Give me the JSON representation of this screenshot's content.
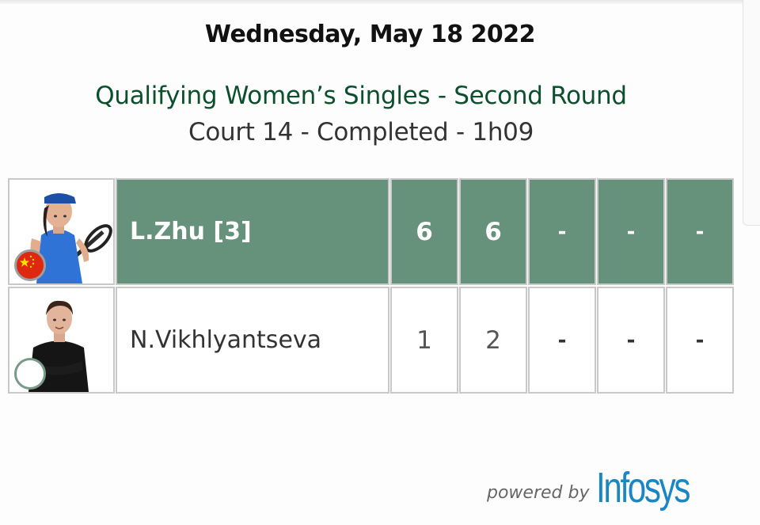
{
  "header": {
    "date": "Wednesday, May 18 2022",
    "round": "Qualifying Women’s Singles - Second Round",
    "court_status": "Court 14 - Completed - 1h09"
  },
  "match": {
    "players": [
      {
        "name": "L.Zhu [3]",
        "winner": true,
        "flag_icon": "china-flag-icon",
        "photo_icon": "player-photo-zhu",
        "scores": [
          "6",
          "6",
          "-",
          "-",
          "-"
        ]
      },
      {
        "name": "N.Vikhlyantseva",
        "winner": false,
        "flag_icon": "empty-flag-icon",
        "photo_icon": "player-photo-vikhlyantseva",
        "scores": [
          "1",
          "2",
          "-",
          "-",
          "-"
        ]
      }
    ]
  },
  "footer": {
    "powered_by": "powered by",
    "brand": "Infosys"
  },
  "colors": {
    "winner_row": "#66917a",
    "round_title": "#0b4f2d",
    "brand": "#1a86c4"
  }
}
